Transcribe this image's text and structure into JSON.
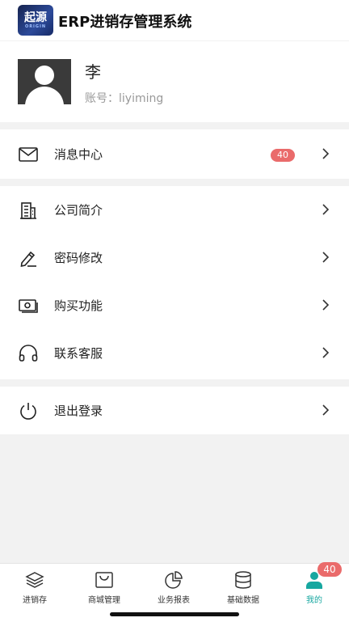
{
  "header": {
    "logo_text": "起源",
    "logo_sub": "ORIGIN",
    "title": "ERP进销存管理系统"
  },
  "profile": {
    "name": "李",
    "account_label": "账号：",
    "account_value": "liyiming"
  },
  "menu": {
    "messages": {
      "label": "消息中心",
      "badge": "40"
    },
    "company": {
      "label": "公司简介"
    },
    "password": {
      "label": "密码修改"
    },
    "purchase": {
      "label": "购买功能"
    },
    "support": {
      "label": "联系客服"
    },
    "logout": {
      "label": "退出登录"
    }
  },
  "tabs": [
    {
      "label": "进销存",
      "icon": "layers-icon"
    },
    {
      "label": "商城管理",
      "icon": "shopping-bag-icon"
    },
    {
      "label": "业务报表",
      "icon": "pie-chart-icon"
    },
    {
      "label": "基础数据",
      "icon": "database-icon"
    },
    {
      "label": "我的",
      "icon": "user-icon",
      "badge": "40",
      "active": true
    }
  ],
  "colors": {
    "accent": "#17a7a0",
    "badge": "#ea6b6b"
  }
}
